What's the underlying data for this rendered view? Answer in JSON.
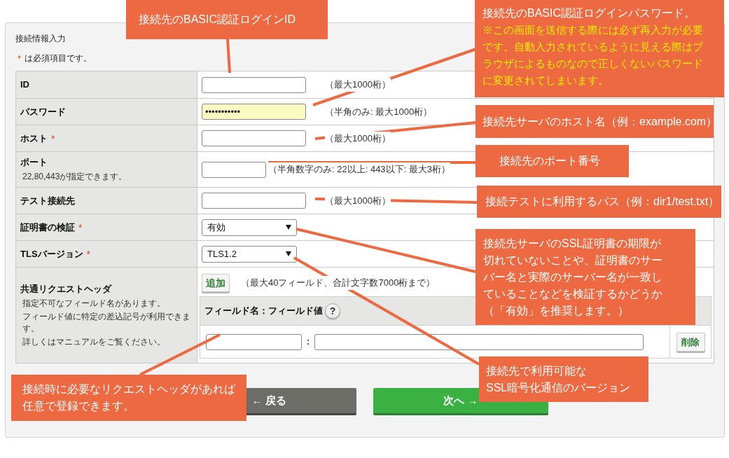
{
  "form": {
    "title": "接続情報入力",
    "required_mark": "*",
    "required_note": "は必須項目です。",
    "rows": [
      {
        "kind": "text",
        "label": "ID",
        "required": false,
        "hint": "（最大1000桁）"
      },
      {
        "kind": "password",
        "label": "パスワード",
        "required": false,
        "value": "•••••••••••",
        "autofilled": true,
        "hint": "（半角のみ: 最大1000桁）"
      },
      {
        "kind": "text",
        "label": "ホスト",
        "required": true,
        "hint": "（最大1000桁）"
      },
      {
        "kind": "number",
        "label": "ポート",
        "required": false,
        "notes": [
          "22,80,443が指定できます。"
        ],
        "hint": "（半角数字のみ: 22以上: 443以下: 最大3桁）"
      },
      {
        "kind": "text",
        "label": "テスト接続先",
        "required": false,
        "hint": "（最大1000桁）"
      },
      {
        "kind": "select",
        "label": "証明書の検証",
        "required": true,
        "value": "有効"
      },
      {
        "kind": "select",
        "label": "TLSバージョン",
        "required": true,
        "value": "TLS1.2"
      },
      {
        "kind": "headers",
        "label": "共通リクエストヘッダ",
        "required": false,
        "notes": [
          "指定不可なフィールド名があります。",
          "フィールド値に特定の差込記号が利用できます。",
          "詳しくはマニュアルをご覧ください。"
        ],
        "add_button": "追加",
        "hint": "（最大40フィールド、合計文字数7000桁まで）",
        "table": {
          "heading": "フィールド名：フィールド値",
          "help": "?",
          "separator": ":",
          "delete_button": "削除"
        }
      }
    ]
  },
  "buttons": [
    {
      "kind": "back",
      "label": "← 戻る"
    },
    {
      "kind": "next",
      "label": "次へ →"
    }
  ],
  "callouts": [
    {
      "lines": [
        "接続先のBASIC認証ログインID"
      ]
    },
    {
      "lines": [
        "接続先のBASIC認証ログインパスワード。"
      ],
      "note_lines": [
        "※この画面を送信する際には必ず再入力が必要",
        "です。自動入力されているように見える際はブ",
        "ラウザによるものなので正しくないパスワード",
        "に変更されてしまいます。"
      ]
    },
    {
      "lines": [
        "接続先サーバのホスト名（例：example.com）"
      ]
    },
    {
      "lines": [
        "接続先のポート番号"
      ]
    },
    {
      "lines": [
        "接続テストに利用するパス（例：dir1/test.txt）"
      ]
    },
    {
      "lines": [
        "接続先サーバのSSL証明書の期限が",
        "切れていないことや、証明書のサー",
        "バー名と実際のサーバー名が一致し",
        "ていることなどを検証するかどうか",
        "（「有効」を推奨します。）"
      ]
    },
    {
      "lines": [
        "接続先で利用可能な",
        "SSL暗号化通信のバージョン"
      ]
    },
    {
      "lines": [
        "接続時に必要なリクエストヘッダがあれば",
        "任意で登録できます。"
      ]
    }
  ]
}
